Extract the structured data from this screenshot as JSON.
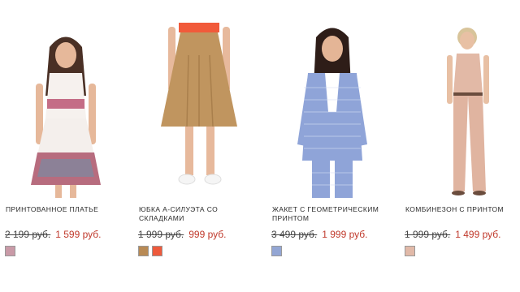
{
  "products": [
    {
      "name": "ПРИНТОВАННОЕ ПЛАТЬЕ",
      "old_price": "2 199 руб.",
      "new_price": "1 599 руб.",
      "swatches": [
        "#c99aa7"
      ]
    },
    {
      "name": "ЮБКА А-СИЛУЭТА СО СКЛАДКАМИ",
      "old_price": "1 999 руб.",
      "new_price": "999 руб.",
      "swatches": [
        "#b88a55",
        "#ee5a3c"
      ]
    },
    {
      "name": "ЖАКЕТ С ГЕОМЕТРИЧЕСКИМ ПРИНТОМ",
      "old_price": "3 499 руб.",
      "new_price": "1 999 руб.",
      "swatches": [
        "#93a6d4"
      ]
    },
    {
      "name": "КОМБИНЕЗОН С ПРИНТОМ",
      "old_price": "1 999 руб.",
      "new_price": "1 499 руб.",
      "swatches": [
        "#e1b9a8"
      ]
    }
  ]
}
